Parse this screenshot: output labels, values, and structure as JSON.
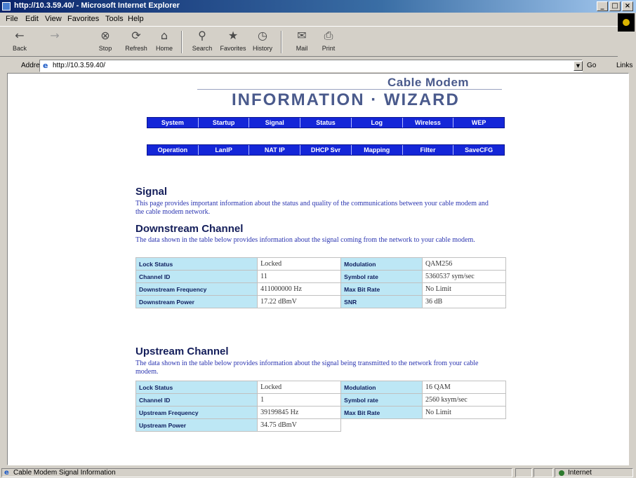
{
  "window": {
    "title": "http://10.3.59.40/ - Microsoft Internet Explorer",
    "controls": [
      "_",
      "□",
      "×"
    ]
  },
  "menu": [
    "File",
    "Edit",
    "View",
    "Favorites",
    "Tools",
    "Help"
  ],
  "toolbar": [
    {
      "label": "Back",
      "icon": "back-arrow-icon",
      "glyph": "←"
    },
    {
      "label": "",
      "icon": "forward-arrow-icon",
      "glyph": "→"
    },
    {
      "label": "Stop",
      "icon": "stop-icon",
      "glyph": "⊗"
    },
    {
      "label": "Refresh",
      "icon": "refresh-icon",
      "glyph": "⟳"
    },
    {
      "label": "Home",
      "icon": "home-icon",
      "glyph": "⌂"
    },
    {
      "label": "Search",
      "icon": "search-icon",
      "glyph": "⚲"
    },
    {
      "label": "Favorites",
      "icon": "favorites-icon",
      "glyph": "★"
    },
    {
      "label": "History",
      "icon": "history-icon",
      "glyph": "◷"
    },
    {
      "label": "Mail",
      "icon": "mail-icon",
      "glyph": "✉"
    },
    {
      "label": "Print",
      "icon": "print-icon",
      "glyph": "⎙"
    }
  ],
  "address": {
    "label": "Address",
    "value": "http://10.3.59.40/",
    "go": "Go",
    "links": "Links"
  },
  "page": {
    "brand_sub": "Cable Modem",
    "brand_main": "INFORMATION · WIZARD",
    "nav_row1": [
      "System",
      "Startup",
      "Signal",
      "Status",
      "Log",
      "Wireless",
      "WEP"
    ],
    "nav_row2": [
      "Operation",
      "LanIP",
      "NAT IP",
      "DHCP Svr",
      "Mapping",
      "Filter",
      "SaveCFG"
    ],
    "signal_title": "Signal",
    "signal_desc": "This page provides important information about the status and quality of the communications between your cable modem and the cable modem network.",
    "downstream_title": "Downstream Channel",
    "downstream_desc": "The data shown in the table below provides information about the signal coming from the network to your cable modem.",
    "downstream_rows": [
      {
        "k1": "Lock Status",
        "v1": "Locked",
        "k2": "Modulation",
        "v2": "QAM256"
      },
      {
        "k1": "Channel ID",
        "v1": "11",
        "k2": "Symbol rate",
        "v2": "5360537 sym/sec"
      },
      {
        "k1": "Downstream Frequency",
        "v1": "411000000 Hz",
        "k2": "Max Bit Rate",
        "v2": "No Limit"
      },
      {
        "k1": "Downstream Power",
        "v1": "17.22 dBmV",
        "k2": "SNR",
        "v2": "36 dB"
      }
    ],
    "upstream_title": "Upstream Channel",
    "upstream_desc": "The data shown in the table below provides information about the signal being transmitted to the network from your cable modem.",
    "upstream_rows": [
      {
        "k1": "Lock Status",
        "v1": "Locked",
        "k2": "Modulation",
        "v2": "16 QAM"
      },
      {
        "k1": "Channel ID",
        "v1": "1",
        "k2": "Symbol rate",
        "v2": "2560 ksym/sec"
      },
      {
        "k1": "Upstream Frequency",
        "v1": "39199845 Hz",
        "k2": "Max Bit Rate",
        "v2": "No Limit"
      },
      {
        "k1": "Upstream Power",
        "v1": "34.75 dBmV",
        "k2": "",
        "v2": ""
      }
    ]
  },
  "status": {
    "text": "Cable Modem Signal Information",
    "zone": "Internet"
  }
}
